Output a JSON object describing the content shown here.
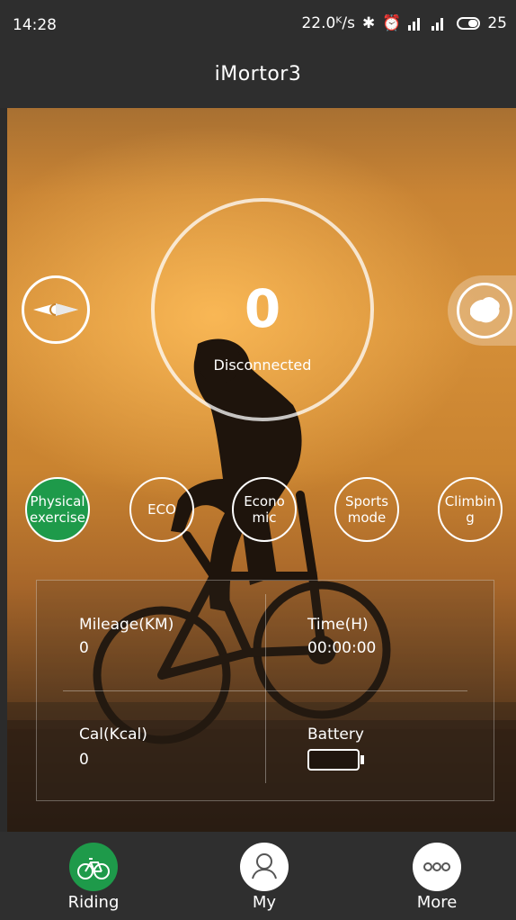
{
  "status_bar": {
    "time": "14:28",
    "net_speed": "22.0ᴷ/s",
    "bluetooth_icon": "bluetooth-icon",
    "alarm_icon": "alarm-icon",
    "signal_icon": "signal-icon",
    "battery_level": "25"
  },
  "app": {
    "title": "iMortor3"
  },
  "speed": {
    "value": "0",
    "status": "Disconnected"
  },
  "side_buttons": {
    "left": "compass-icon",
    "right": "china-map-icon"
  },
  "modes": [
    {
      "label": "Physical exercise",
      "active": true
    },
    {
      "label": "ECO",
      "active": false
    },
    {
      "label": "Econo mic",
      "active": false
    },
    {
      "label": "Sports mode",
      "active": false
    },
    {
      "label": "Climbin g",
      "active": false
    }
  ],
  "stats": {
    "mileage_label": "Mileage(KM)",
    "mileage_value": "0",
    "time_label": "Time(H)",
    "time_value": "00:00:00",
    "cal_label": "Cal(Kcal)",
    "cal_value": "0",
    "battery_label": "Battery"
  },
  "nav": [
    {
      "label": "Riding",
      "icon": "bicycle-icon",
      "active": true
    },
    {
      "label": "My",
      "icon": "person-icon",
      "active": false
    },
    {
      "label": "More",
      "icon": "more-dots-icon",
      "active": false
    }
  ],
  "colors": {
    "active_green": "#1e9a4a",
    "bar_bg": "#2e2e2e"
  }
}
